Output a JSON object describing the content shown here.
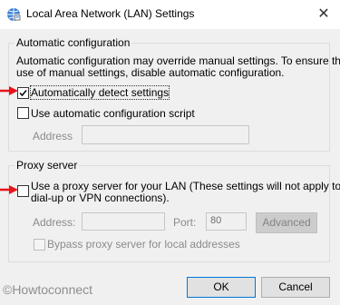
{
  "window": {
    "title": "Local Area Network (LAN) Settings",
    "close_glyph": "✕"
  },
  "auto_config": {
    "legend": "Automatic configuration",
    "desc_line1": "Automatic configuration may override manual settings.  To ensure the",
    "desc_line2": "use of manual settings, disable automatic configuration.",
    "detect_label": "Automatically detect settings",
    "detect_checked": true,
    "script_label": "Use automatic configuration script",
    "script_checked": false,
    "address_label": "Address",
    "address_value": ""
  },
  "proxy": {
    "legend": "Proxy server",
    "use_proxy_line1": "Use a proxy server for your LAN (These settings will not apply to",
    "use_proxy_line2": "dial-up or VPN connections).",
    "use_proxy_checked": false,
    "address_label": "Address:",
    "address_value": "",
    "port_label": "Port:",
    "port_value": "80",
    "advanced_label": "Advanced",
    "bypass_label": "Bypass proxy server for local addresses",
    "bypass_checked": false
  },
  "footer": {
    "ok_label": "OK",
    "cancel_label": "Cancel"
  },
  "watermark": "©Howtoconnect",
  "colors": {
    "arrow": "#e8141a",
    "default_button_border": "#0078d7"
  }
}
